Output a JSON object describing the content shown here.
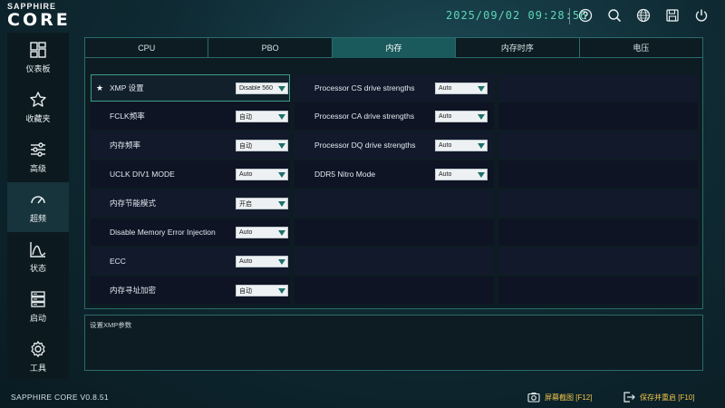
{
  "header": {
    "logo_top": "SAPPHIRE",
    "logo_main": "CORE",
    "datetime": "2025/09/02 09:28:56",
    "icons": [
      "help-icon",
      "search-icon",
      "globe-icon",
      "save-icon",
      "power-icon"
    ]
  },
  "sidebar": {
    "items": [
      {
        "label": "仪表板",
        "icon": "dashboard-icon"
      },
      {
        "label": "收藏夹",
        "icon": "star-icon"
      },
      {
        "label": "高级",
        "icon": "sliders-icon"
      },
      {
        "label": "超频",
        "icon": "gauge-icon",
        "active": true
      },
      {
        "label": "状态",
        "icon": "chart-icon"
      },
      {
        "label": "启动",
        "icon": "boot-icon"
      },
      {
        "label": "工具",
        "icon": "gear-icon"
      }
    ]
  },
  "tabs": [
    {
      "label": "CPU"
    },
    {
      "label": "PBO"
    },
    {
      "label": "内存",
      "active": true
    },
    {
      "label": "内存时序"
    },
    {
      "label": "电压"
    }
  ],
  "left_settings": [
    {
      "label": "XMP 设置",
      "value": "Disable 560",
      "favorite": true,
      "selected": true
    },
    {
      "label": "FCLK频率",
      "value": "自动"
    },
    {
      "label": "内存频率",
      "value": "自动"
    },
    {
      "label": "UCLK DIV1 MODE",
      "value": "Auto"
    },
    {
      "label": "内存节能模式",
      "value": "开启"
    },
    {
      "label": "Disable Memory Error Injection",
      "value": "Auto"
    },
    {
      "label": "ECC",
      "value": "Auto"
    },
    {
      "label": "内存寻址加密",
      "value": "自动"
    }
  ],
  "right_settings": [
    {
      "label": "Processor CS drive strengths",
      "value": "Auto"
    },
    {
      "label": "Processor CA drive strengths",
      "value": "Auto"
    },
    {
      "label": "Processor DQ drive strengths",
      "value": "Auto"
    },
    {
      "label": "DDR5 Nitro Mode",
      "value": "Auto"
    }
  ],
  "description": "设置XMP参数",
  "footer": {
    "version": "SAPPHIRE CORE V0.8.51",
    "screenshot_label": "屏幕截图 [F12]",
    "save_restart_label": "保存并重启 [F10]"
  },
  "colors": {
    "accent": "#2a6b6b",
    "active_tab": "#1a5a5c",
    "clock": "#5fd6b8",
    "footer_text": "#f0c44a"
  }
}
